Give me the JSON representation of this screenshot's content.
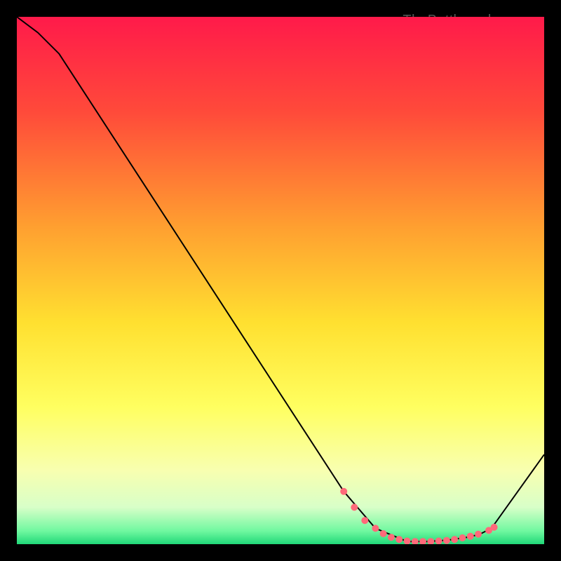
{
  "watermark": "TheBottlenecker.com",
  "chart_data": {
    "type": "line",
    "title": "",
    "xlabel": "",
    "ylabel": "",
    "xlim": [
      0,
      100
    ],
    "ylim": [
      0,
      100
    ],
    "background_gradient": {
      "stops": [
        {
          "offset": 0.0,
          "color": "#ff1a4a"
        },
        {
          "offset": 0.18,
          "color": "#ff4a3a"
        },
        {
          "offset": 0.4,
          "color": "#ffa030"
        },
        {
          "offset": 0.58,
          "color": "#ffe030"
        },
        {
          "offset": 0.74,
          "color": "#ffff60"
        },
        {
          "offset": 0.86,
          "color": "#f8ffb0"
        },
        {
          "offset": 0.93,
          "color": "#d8ffc8"
        },
        {
          "offset": 0.975,
          "color": "#70f8a0"
        },
        {
          "offset": 1.0,
          "color": "#20d878"
        }
      ]
    },
    "series": [
      {
        "name": "bottleneck-curve",
        "color": "#000000",
        "x": [
          0,
          4,
          8,
          62,
          68,
          74,
          78,
          82,
          86,
          88,
          90,
          100
        ],
        "y": [
          100,
          97,
          93,
          10,
          3,
          0.5,
          0.5,
          0.8,
          1.4,
          2.0,
          3.0,
          17
        ]
      }
    ],
    "markers": {
      "name": "highlight-range",
      "color": "#ff6a7a",
      "radius": 5,
      "points": [
        {
          "x": 62,
          "y": 10
        },
        {
          "x": 64,
          "y": 7
        },
        {
          "x": 66,
          "y": 4.5
        },
        {
          "x": 68,
          "y": 3
        },
        {
          "x": 69.5,
          "y": 2
        },
        {
          "x": 71,
          "y": 1.3
        },
        {
          "x": 72.5,
          "y": 0.9
        },
        {
          "x": 74,
          "y": 0.6
        },
        {
          "x": 75.5,
          "y": 0.5
        },
        {
          "x": 77,
          "y": 0.5
        },
        {
          "x": 78.5,
          "y": 0.5
        },
        {
          "x": 80,
          "y": 0.6
        },
        {
          "x": 81.5,
          "y": 0.7
        },
        {
          "x": 83,
          "y": 0.9
        },
        {
          "x": 84.5,
          "y": 1.2
        },
        {
          "x": 86,
          "y": 1.5
        },
        {
          "x": 87.5,
          "y": 1.9
        },
        {
          "x": 89.5,
          "y": 2.6
        },
        {
          "x": 90.5,
          "y": 3.2
        }
      ]
    }
  }
}
